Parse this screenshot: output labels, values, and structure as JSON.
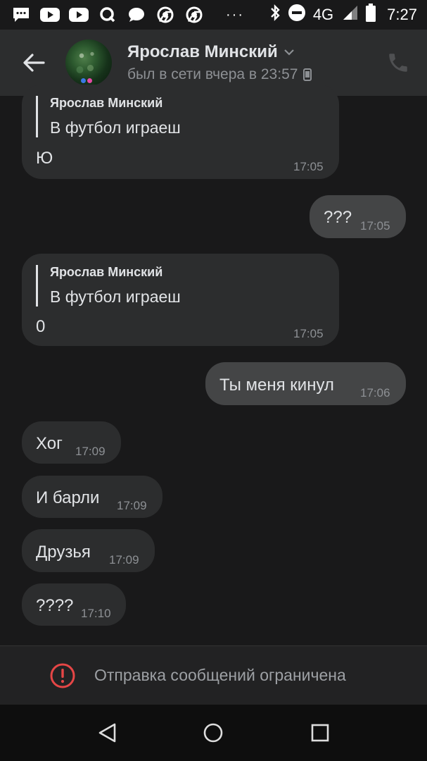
{
  "status_bar": {
    "time": "7:27",
    "network": "4G",
    "more_dots": "···",
    "icons": [
      "messages-icon",
      "youtube-icon",
      "youtube-icon",
      "q-icon",
      "chat-icon",
      "chrome-icon",
      "chrome-icon",
      "bluetooth-icon",
      "dnd-icon",
      "signal-icon",
      "battery-icon"
    ]
  },
  "header": {
    "name": "Ярослав Минский",
    "last_seen": "был в сети вчера в 23:57",
    "icons": [
      "back-arrow-icon",
      "chevron-down-icon",
      "mobile-device-icon",
      "phone-icon"
    ]
  },
  "messages": [
    {
      "direction": "in",
      "reply_author": "Ярослав Минский",
      "reply_text": "В футбол играеш",
      "text": "Ю",
      "time": "17:05"
    },
    {
      "direction": "out",
      "text": "???",
      "time": "17:05"
    },
    {
      "direction": "in",
      "reply_author": "Ярослав Минский",
      "reply_text": "В футбол играеш",
      "text": "0",
      "time": "17:05"
    },
    {
      "direction": "out",
      "text": "Ты меня кинул",
      "time": "17:06"
    },
    {
      "direction": "in",
      "text": "Хог",
      "time": "17:09"
    },
    {
      "direction": "in",
      "text": "И барли",
      "time": "17:09"
    },
    {
      "direction": "in",
      "text": "Друзья",
      "time": "17:09"
    },
    {
      "direction": "in",
      "text": "????",
      "time": "17:10"
    }
  ],
  "restriction": {
    "text": "Отправка сообщений ограничена",
    "icon": "alert-circle-icon",
    "color": "#e64646"
  },
  "nav_bar": {
    "icons": [
      "nav-back-icon",
      "nav-home-icon",
      "nav-recents-icon"
    ]
  },
  "colors": {
    "background": "#19191a",
    "header": "#2c2d2e",
    "bubble_in": "#2c2d2e",
    "bubble_out": "#444546",
    "text": "#e1e3e6",
    "secondary": "#8d9094"
  }
}
